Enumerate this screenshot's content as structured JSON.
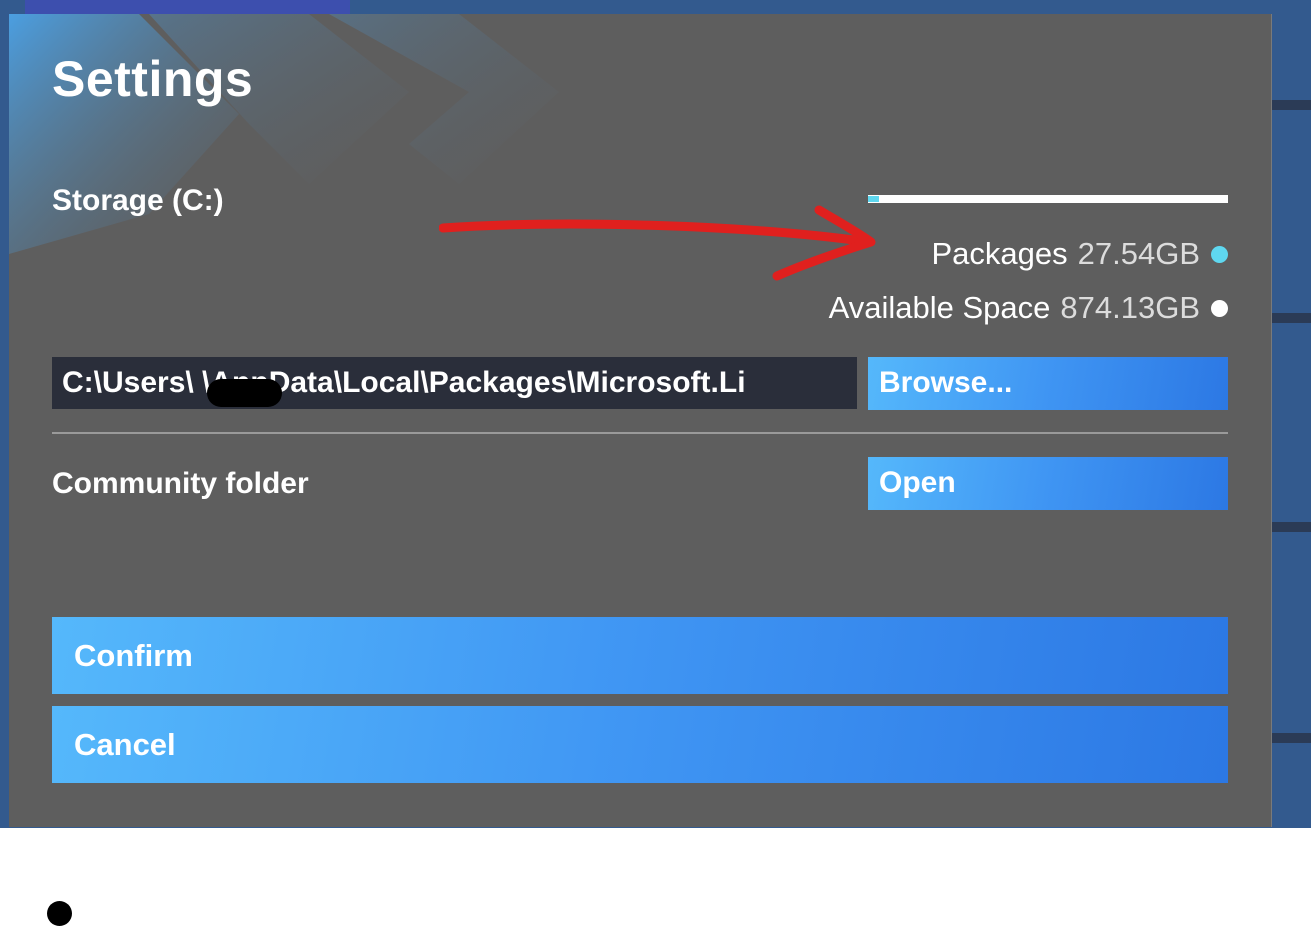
{
  "dialog": {
    "title": "Settings",
    "storage": {
      "label": "Storage (C:)",
      "used_fraction": 0.03,
      "packages_label": "Packages",
      "packages_value": "27.54GB",
      "packages_color": "#5fd8f0",
      "available_label": "Available Space",
      "available_value": "874.13GB",
      "available_color": "#ffffff"
    },
    "path": {
      "value": "C:\\Users\\        \\AppData\\Local\\Packages\\Microsoft.Li"
    },
    "browse_label": "Browse...",
    "community_label": "Community folder",
    "open_label": "Open",
    "confirm_label": "Confirm",
    "cancel_label": "Cancel"
  },
  "colors": {
    "dialog_bg": "#5e5e5e",
    "button_blue": "#3f95f3",
    "annotation_red": "#e0201e"
  }
}
